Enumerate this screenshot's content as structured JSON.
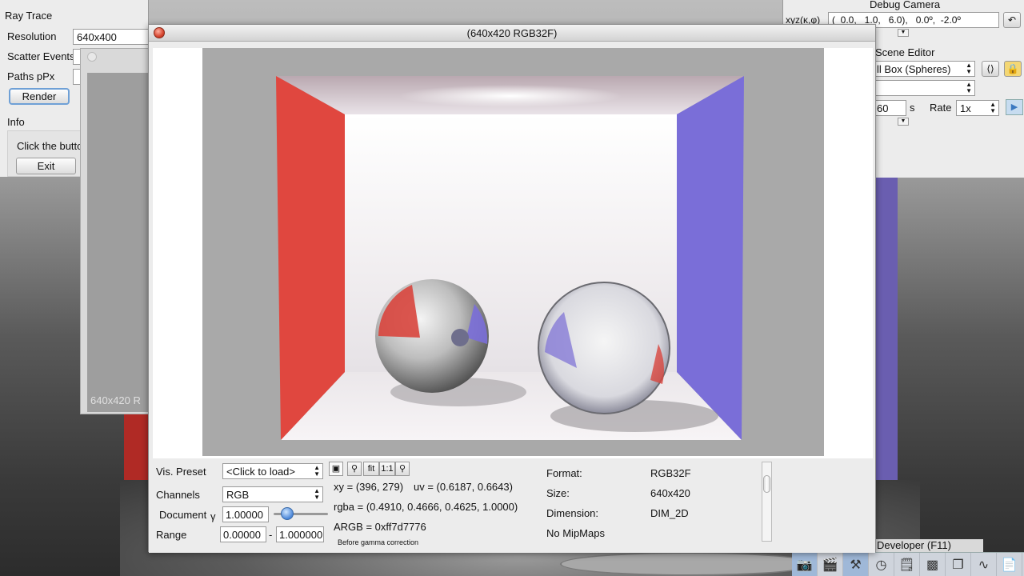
{
  "raytrace_panel": {
    "title": "Ray Trace",
    "resolution_label": "Resolution",
    "resolution_value": "640x400",
    "scatter_label": "Scatter Events",
    "paths_label": "Paths pPx",
    "render_label": "Render",
    "info_label": "Info",
    "info_text": "Click the butto",
    "exit_label": "Exit"
  },
  "behind_window": {
    "label": "640x420 R"
  },
  "debug_camera": {
    "title": "Debug Camera",
    "xyz_label": "xyz(ĸ,φ)",
    "camera_value": "(  0.0,   1.0,   6.0),   0.0º,  -2.0º"
  },
  "scene_editor": {
    "title": "Scene Editor",
    "scene_value": "ll Box (Spheres)",
    "time_value": "60",
    "time_unit": "s",
    "rate_label": "Rate",
    "rate_value": "1x"
  },
  "image_window": {
    "title": "(640x420 RGB32F)",
    "vis_preset_label": "Vis. Preset",
    "vis_preset_value": "<Click to load>",
    "channels_label": "Channels",
    "channels_value": "RGB",
    "document_label": "Document",
    "gamma_symbol": "γ",
    "gamma_value": "1.00000",
    "gamma_fraction": 0.25,
    "range_label": "Range",
    "range_min": "0.00000",
    "range_sep": "-",
    "range_max": "1.000000",
    "tool_fit": "fit",
    "tool_1to1": "1:1",
    "xy_text": "xy =  (396, 279)",
    "uv_text": "uv =  (0.6187, 0.6643)",
    "rgba_text": "rgba =  (0.4910, 0.4666, 0.4625, 1.0000)",
    "argb_text": "ARGB =  0xff7d7776",
    "gamma_note": "Before gamma correction",
    "format_label": "Format:",
    "format_value": "RGB32F",
    "size_label": "Size:",
    "size_value": "640x420",
    "dimension_label": "Dimension:",
    "dimension_value": "DIM_2D",
    "mipmaps_text": "No MipMaps"
  },
  "developer": {
    "label": "Developer (F11)"
  },
  "colors": {
    "red_wall": "#e0473f",
    "blue_wall": "#7a6ed8",
    "accent": "#4a86d8"
  }
}
